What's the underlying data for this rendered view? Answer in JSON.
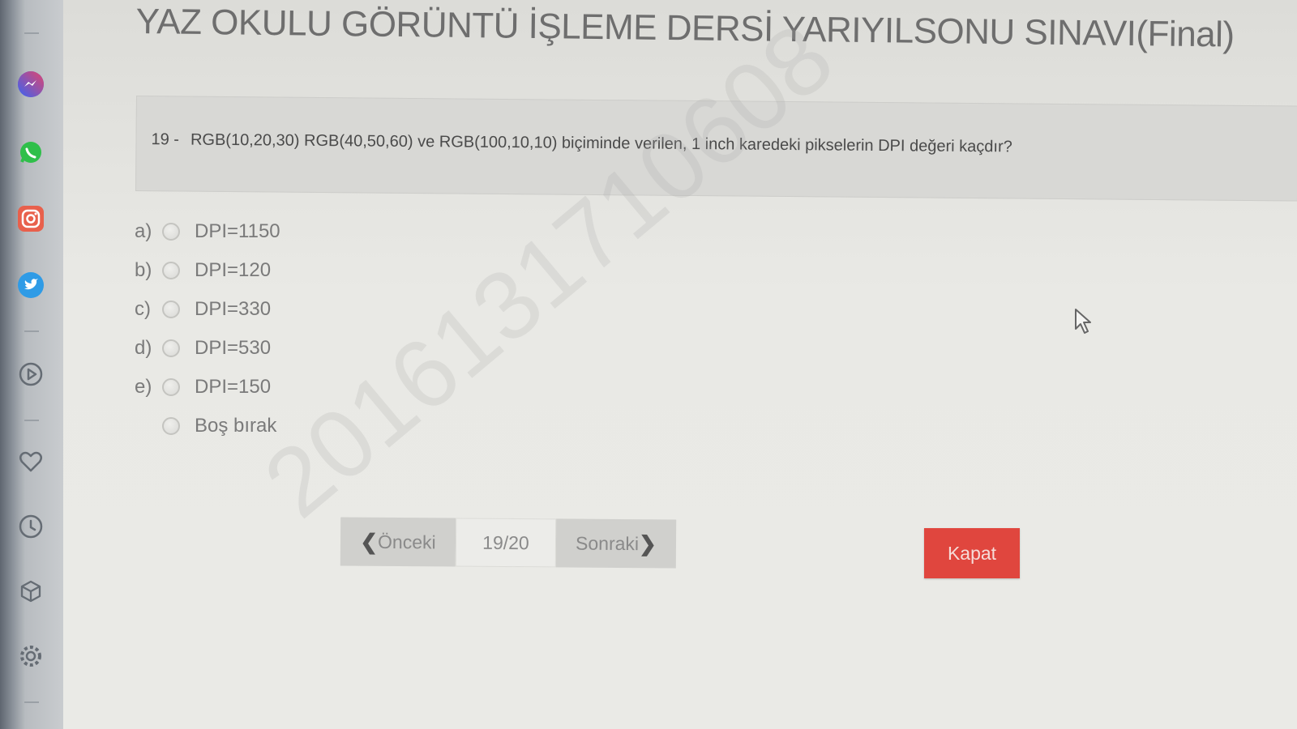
{
  "exam": {
    "title": "YAZ OKULU GÖRÜNTÜ İŞLEME DERSİ YARIYILSONU SINAVI(Final)"
  },
  "question": {
    "number": "19 -",
    "text": "RGB(10,20,30) RGB(40,50,60) ve RGB(100,10,10) biçiminde verilen, 1 inch karedeki pikselerin DPI değeri kaçdır?"
  },
  "options": [
    {
      "letter": "a)",
      "text": "DPI=1150"
    },
    {
      "letter": "b)",
      "text": "DPI=120"
    },
    {
      "letter": "c)",
      "text": "DPI=330"
    },
    {
      "letter": "d)",
      "text": "DPI=530"
    },
    {
      "letter": "e)",
      "text": "DPI=150"
    },
    {
      "letter": "",
      "text": "Boş bırak"
    }
  ],
  "watermark": "2016131710608",
  "pager": {
    "prev_label": "Önceki",
    "page": "19/20",
    "next_label": "Sonraki"
  },
  "close_label": "Kapat",
  "dock_icons": [
    "messenger-icon",
    "whatsapp-icon",
    "instagram-icon",
    "twitter-icon",
    "play-icon",
    "heart-icon",
    "clock-icon",
    "cube-icon",
    "settings-icon"
  ],
  "colors": {
    "close_button": "#e0463e",
    "messenger": "#4a6cf7",
    "whatsapp": "#2fbf4a",
    "instagram": "#e8604c",
    "twitter": "#2f9be6"
  }
}
